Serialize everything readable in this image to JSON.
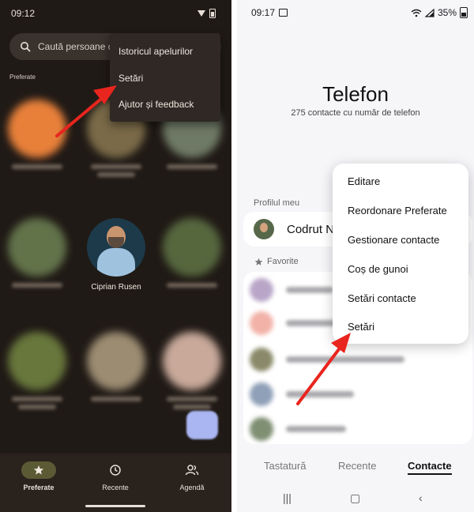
{
  "left": {
    "status_time": "09:12",
    "search_placeholder": "Caută persoane d",
    "section_label": "Preferate",
    "featured_contact": "Ciprian Rusen",
    "menu": [
      "Istoricul apelurilor",
      "Setări",
      "Ajutor și feedback"
    ],
    "nav": [
      {
        "label": "Preferate",
        "icon": "star-icon",
        "active": true
      },
      {
        "label": "Recente",
        "icon": "clock-icon",
        "active": false
      },
      {
        "label": "Agendă",
        "icon": "contacts-icon",
        "active": false
      }
    ]
  },
  "right": {
    "status_time": "09:17",
    "battery": "35%",
    "title": "Telefon",
    "subtitle": "275 contacte cu număr de telefon",
    "profile_label": "Profilul meu",
    "profile_name": "Codrut N",
    "favorites_label": "Favorite",
    "menu": [
      "Editare",
      "Reordonare Preferate",
      "Gestionare contacte",
      "Coș de gunoi",
      "Setări contacte",
      "Setări"
    ],
    "tabs": [
      {
        "label": "Tastatură",
        "active": false
      },
      {
        "label": "Recente",
        "active": false
      },
      {
        "label": "Contacte",
        "active": true
      }
    ],
    "system_nav": [
      "|||",
      "▢",
      "‹"
    ]
  },
  "colors": {
    "annotation_arrow": "#e8251e",
    "left_background": "#201a16",
    "right_background": "#f6f5f8"
  }
}
